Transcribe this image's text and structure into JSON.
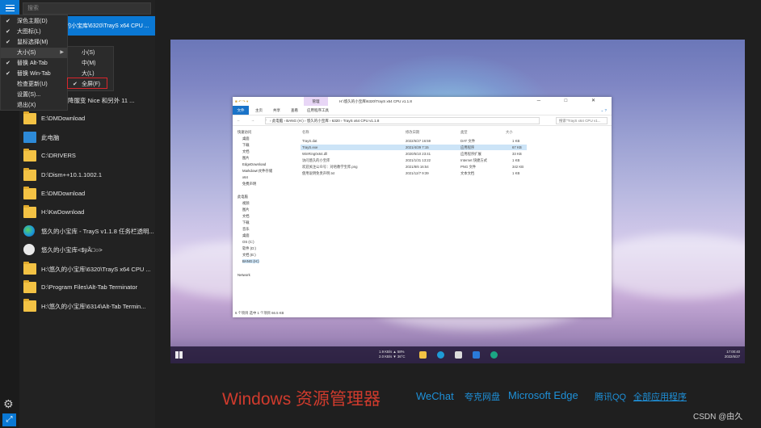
{
  "search": {
    "placeholder": "搜索"
  },
  "active_item": {
    "label": "H:\\悠久的小宝库\\6320\\TrayS x64 CPU ..."
  },
  "settings_menu": {
    "items": [
      {
        "label": "深色主题(D)",
        "checked": true
      },
      {
        "label": "大图标(L)",
        "checked": true
      },
      {
        "label": "鼠标选择(M)",
        "checked": true
      },
      {
        "label": "大小(S)",
        "checked": false,
        "submenu": true,
        "selected": true
      },
      {
        "label": "替换 Alt-Tab",
        "checked": true
      },
      {
        "label": "替换 Win-Tab",
        "checked": true
      },
      {
        "label": "检查更新(U)",
        "checked": false
      },
      {
        "label": "设置(S)...",
        "checked": false
      },
      {
        "label": "退出(X)",
        "checked": false
      }
    ]
  },
  "size_submenu": {
    "items": [
      {
        "label": "小(S)",
        "checked": false
      },
      {
        "label": "中(M)",
        "checked": false
      },
      {
        "label": "大(L)",
        "checked": false
      },
      {
        "label": "全屏(F)",
        "checked": true
      }
    ]
  },
  "window_list": {
    "partial_label": "...n | 让降服变 Nice 和另外 11 ...",
    "items": [
      {
        "icon": "folder-icon",
        "label": "E:\\DMDownload"
      },
      {
        "icon": "computer-icon",
        "label": "此电脑"
      },
      {
        "icon": "folder-icon",
        "label": "C:\\DRIVERS"
      },
      {
        "icon": "folder-icon",
        "label": "D:\\Dism++10.1.1002.1"
      },
      {
        "icon": "folder-icon",
        "label": "E:\\DMDownload"
      },
      {
        "icon": "folder-icon",
        "label": "H:\\KwDownload"
      },
      {
        "icon": "edge-icon",
        "label": "悠久的小宝库 - TrayS v1.1.8 任务栏透明..."
      },
      {
        "icon": "avatar-icon",
        "label": "悠久的小宝库<$ÿÃ□○>"
      },
      {
        "icon": "folder-icon",
        "label": "H:\\悠久的小宝库\\6320\\TrayS x64 CPU ..."
      },
      {
        "icon": "folder-icon",
        "label": "D:\\Program Files\\Alt-Tab Terminator"
      },
      {
        "icon": "folder-icon",
        "label": "H:\\悠久的小宝库\\6314\\Alt-Tab Termin..."
      }
    ]
  },
  "explorer": {
    "title": "H:\\悠久的小宝库\\6320\\TrayS x64 CPU v1.1.8",
    "manage_tab": "管理",
    "ribbon_tabs": [
      "文件",
      "主页",
      "共享",
      "查看",
      "应用程序工具"
    ],
    "window_controls": "─ □ ✕",
    "nav_arrows": "← → ↑",
    "path": "› 此电脑 › BANG (H:) › 悠久的小宝库 › 6320 › TrayS x64 CPU v1.1.8",
    "search_placeholder": "搜索\"TrayS x64 CPU v1...",
    "sidebar": [
      "快速访问",
      "桌面",
      "下载",
      "文档",
      "图片",
      "EdgeDownload",
      "Markdown文件存储",
      "x64",
      "免费声明",
      "此电脑",
      "视频",
      "图片",
      "文档",
      "下载",
      "音乐",
      "桌面",
      "OS (C:)",
      "软件 (D:)",
      "文档 (E:)",
      "BANG (H:)",
      "Network"
    ],
    "columns": [
      "名称",
      "修改日期",
      "类型",
      "大小"
    ],
    "files": [
      {
        "name": "TrayS.dat",
        "date": "2022/6/27 16:59",
        "type": "DAT 文件",
        "size": "1 KB"
      },
      {
        "name": "TrayS.exe",
        "date": "2021/4/29 7:15",
        "type": "应用程序",
        "size": "67 KB"
      },
      {
        "name": "WinRing0x64.dll",
        "date": "2020/5/10 23:41",
        "type": "应用程序扩展",
        "size": "33 KB"
      },
      {
        "name": "访问悠久的小宝库",
        "date": "2021/1/31 13:22",
        "type": "Internet 快捷方式",
        "size": "1 KB"
      },
      {
        "name": "欢迎关注公众号：对唔教学宝库.png",
        "date": "2021/8/6 16:54",
        "type": "PNG 文件",
        "size": "342 KB"
      },
      {
        "name": "使用说明免责声明.txt",
        "date": "2021/12/7 9:39",
        "type": "文本文档",
        "size": "1 KB"
      }
    ],
    "status": "6 个项目    选中 1 个项目  66.5 KB"
  },
  "taskbar": {
    "net_up": "1.9 KB/s ▲ 58%",
    "net_down": "2.0 KB/s ▼ 36°C",
    "time": "17:00:40",
    "date": "2022/6/27"
  },
  "caption": {
    "windows_explorer": "Windows 资源管理器",
    "wechat": "WeChat",
    "kuake": "夸克网盘",
    "edge": "Microsoft Edge",
    "qq": "腾讯QQ",
    "all_apps": "全部应用程序",
    "watermark": "CSDN @由久"
  },
  "colors": {
    "accent": "#0a78d4",
    "caption_red": "#d03b2d",
    "caption_blue": "#1e90d8",
    "highlight_box": "#d9262c"
  }
}
